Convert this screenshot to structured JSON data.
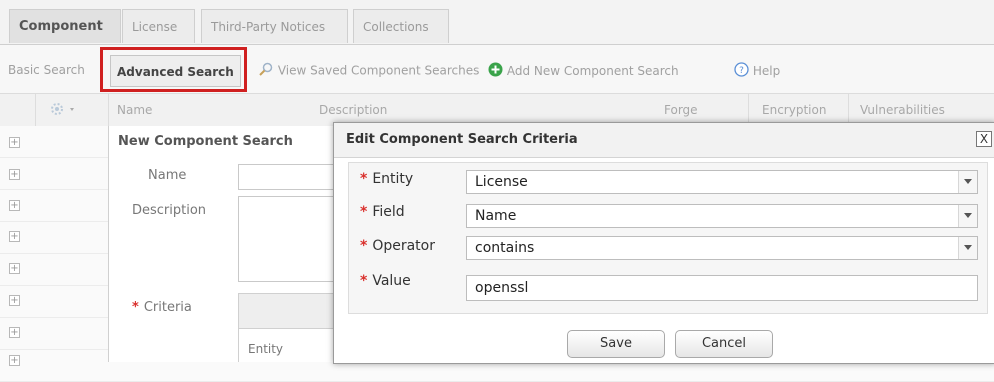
{
  "tabs": [
    {
      "label": "Component",
      "active": true
    },
    {
      "label": "License",
      "active": false
    },
    {
      "label": "Third-Party Notices",
      "active": false
    },
    {
      "label": "Collections",
      "active": false
    }
  ],
  "toolbar": {
    "basic_search": "Basic Search",
    "advanced_search": "Advanced Search",
    "view_saved": "View Saved Component Searches",
    "add_new": "Add New Component Search",
    "help": "Help"
  },
  "table": {
    "columns": [
      "Name",
      "Description",
      "Forge",
      "Encryption",
      "Vulnerabilities"
    ]
  },
  "new_search_panel": {
    "title": "New Component Search",
    "name_label": "Name",
    "description_label": "Description",
    "criteria_label": "Criteria",
    "entity_col": "Entity"
  },
  "dialog": {
    "title": "Edit Component Search Criteria",
    "close": "X",
    "fields": {
      "entity": {
        "label": "Entity",
        "value": "License"
      },
      "field": {
        "label": "Field",
        "value": "Name"
      },
      "operator": {
        "label": "Operator",
        "value": "contains"
      },
      "value": {
        "label": "Value",
        "value": "openssl"
      }
    },
    "required_mark": "*",
    "save": "Save",
    "cancel": "Cancel"
  },
  "colors": {
    "highlight": "#d02020",
    "required": "#d9302c",
    "add_icon": "#3aa34a"
  }
}
